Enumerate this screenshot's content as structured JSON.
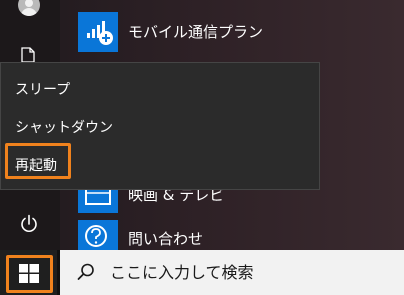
{
  "start_menu": {
    "tiles": [
      {
        "label": "モバイル通信プラン",
        "icon": "mobile-plan-icon"
      },
      {
        "label": "映画 & テレビ",
        "icon": "movies-tv-icon"
      },
      {
        "label": "問い合わせ",
        "icon": "get-help-icon"
      }
    ],
    "rail": {
      "icons": [
        "user-avatar-icon",
        "document-icon",
        "power-icon"
      ]
    }
  },
  "power_menu": {
    "items": [
      {
        "label": "スリープ"
      },
      {
        "label": "シャットダウン"
      },
      {
        "label": "再起動",
        "highlighted": true
      }
    ]
  },
  "taskbar": {
    "start_icon": "windows-logo-icon",
    "search": {
      "placeholder": "ここに入力して検索",
      "icon": "search-icon"
    }
  },
  "colors": {
    "tile_blue": "#0a76d8",
    "highlight_orange": "#f0821d",
    "menu_bg": "#2b2b2b",
    "taskbar_bg": "#101010",
    "search_bg": "#f2f2f2"
  }
}
